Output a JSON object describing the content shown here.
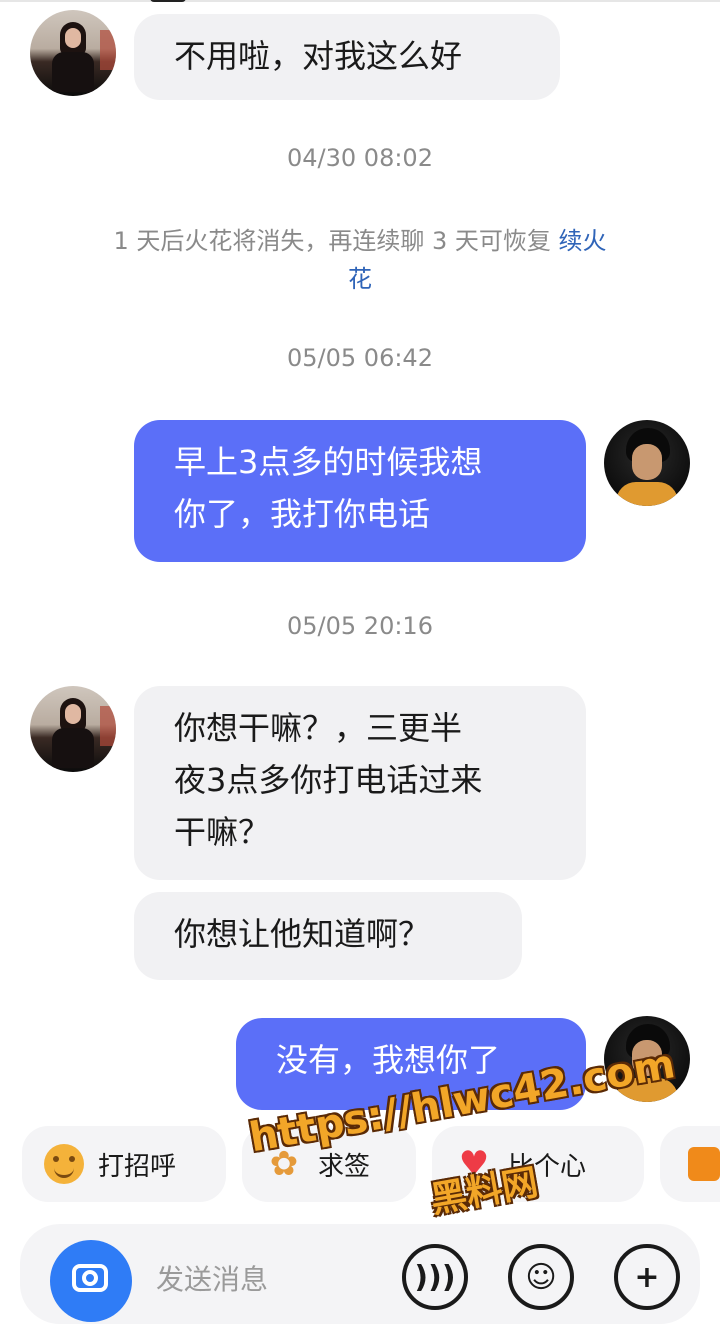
{
  "messages": [
    {
      "text": "不用啦，对我这么好"
    },
    {
      "time": "04/30 08:02"
    },
    {
      "notice": "1 天后火花将消失，再连续聊 3 天可恢复",
      "notice_link": "续火花"
    },
    {
      "time": "05/05 06:42"
    },
    {
      "line1": "早上3点多的时候我想",
      "line2": "你了，我打你电话"
    },
    {
      "time": "05/05 20:16"
    },
    {
      "line1": "你想干嘛？，三更半",
      "line2": "夜3点多你打电话过来",
      "line3": "干嘛？"
    },
    {
      "text": "你想让他知道啊？"
    },
    {
      "text": "没有，我想你了"
    }
  ],
  "quick_replies": [
    {
      "label": "打招呼",
      "icon": "smiley-icon"
    },
    {
      "label": "求签",
      "icon": "fortune-icon"
    },
    {
      "label": "比个心",
      "icon": "heart-icon"
    },
    {
      "label": "",
      "icon": "people-icon"
    }
  ],
  "input": {
    "placeholder": "发送消息"
  },
  "watermark": {
    "line1": "https://hlwc42.com",
    "line2": "黑料网"
  },
  "colors": {
    "outgoing_bubble": "#5b6ff8",
    "incoming_bubble": "#f1f1f3",
    "link": "#2f64b8"
  }
}
